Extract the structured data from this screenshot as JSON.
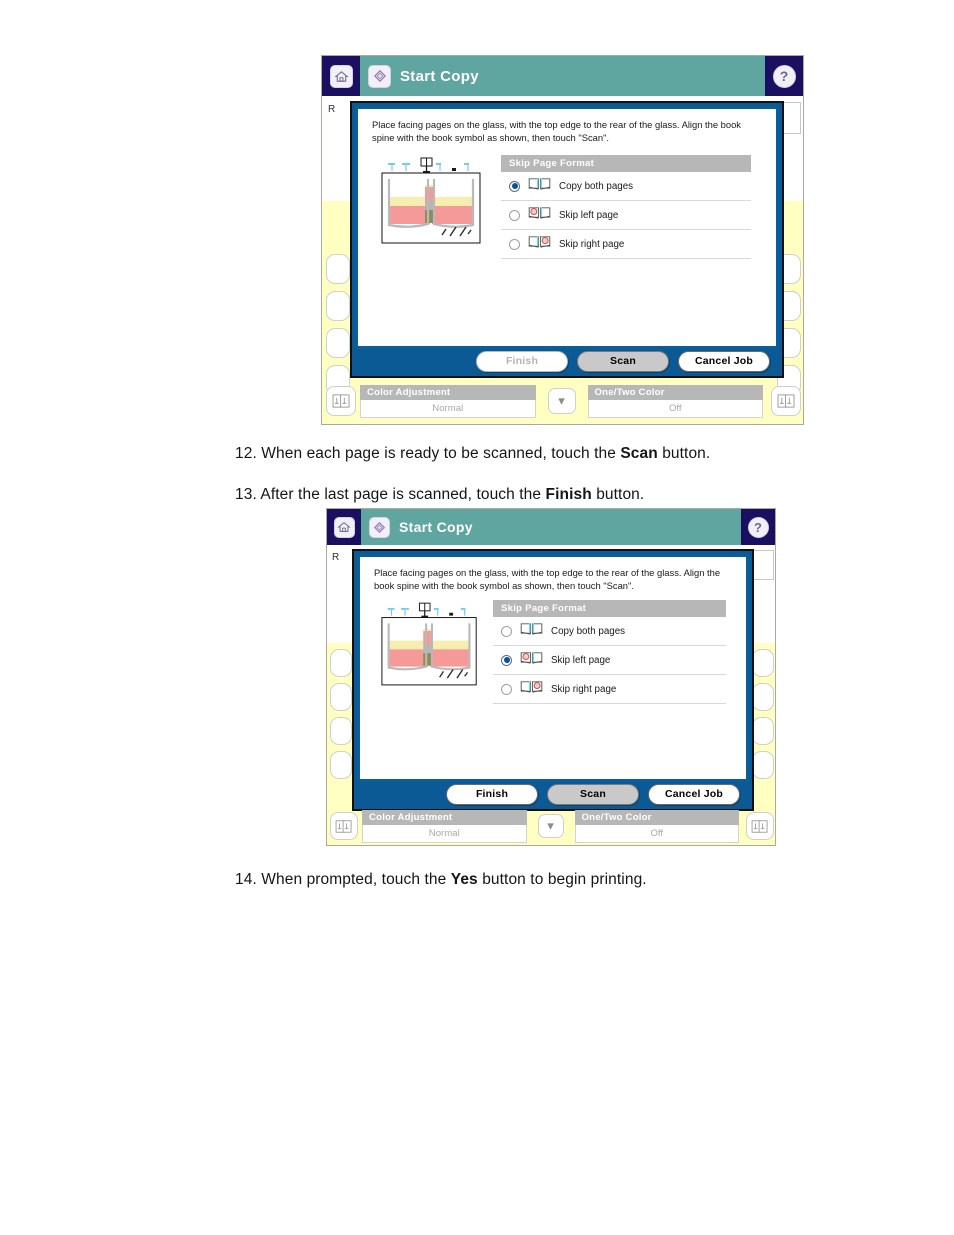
{
  "document": {
    "steps": [
      {
        "number": "12.",
        "text_before": "When each page is ready to be scanned, touch the ",
        "bold": "Scan",
        "text_after": " button."
      },
      {
        "number": "13.",
        "text_before": "After the last page is scanned, touch the ",
        "bold": "Finish",
        "text_after": " button."
      },
      {
        "number": "14.",
        "text_before": "When prompted, touch the ",
        "bold": "Yes",
        "text_after": " button to begin printing."
      }
    ]
  },
  "colors": {
    "header_navy": "#1a0f60",
    "header_teal": "#5fa5a0",
    "dialog_blue": "#0b5a96",
    "panel_yellow": "#ffffc1",
    "section_grey": "#b7b7b7",
    "radio_selected": "#0b4f9e",
    "scan_button_grey": "#c9c9c9"
  },
  "screens": [
    {
      "id": "screen-copy-both",
      "header": {
        "home_icon": "home-icon",
        "app_icon": "diamond-icon",
        "title": "Start Copy",
        "help_icon": "question-mark-icon",
        "help_label": "?"
      },
      "background": {
        "residual_text": "R",
        "tabs_left_count": 5,
        "tabs_right_count": 5
      },
      "dialog": {
        "instruction": "Place facing pages on the glass, with the top edge to the rear of the glass. Align the book spine with the book symbol as shown, then touch \"Scan\".",
        "illustration": "book-on-glass-illustration",
        "section_title": "Skip Page Format",
        "options": [
          {
            "label": "Copy both pages",
            "icon": "open-book-icon",
            "selected": true,
            "enabled": true,
            "skip_side": "none"
          },
          {
            "label": "Skip left page",
            "icon": "open-book-skip-left-icon",
            "selected": false,
            "enabled": false,
            "skip_side": "left"
          },
          {
            "label": "Skip right page",
            "icon": "open-book-skip-right-icon",
            "selected": false,
            "enabled": false,
            "skip_side": "right"
          }
        ],
        "buttons": [
          {
            "label": "Finish",
            "state": "disabled"
          },
          {
            "label": "Scan",
            "state": "highlighted"
          },
          {
            "label": "Cancel Job",
            "state": "normal"
          }
        ]
      },
      "settings_strip": {
        "left_icon": "color-balance-icon",
        "right_icon": "color-balance-icon",
        "chevron_icon": "chevron-down-icon",
        "fields": [
          {
            "title": "Color Adjustment",
            "value": "Normal"
          },
          {
            "title": "One/Two Color",
            "value": "Off"
          }
        ]
      }
    },
    {
      "id": "screen-skip-left",
      "header": {
        "home_icon": "home-icon",
        "app_icon": "diamond-icon",
        "title": "Start Copy",
        "help_icon": "question-mark-icon",
        "help_label": "?"
      },
      "background": {
        "residual_text": "R",
        "tabs_left_count": 5,
        "tabs_right_count": 5
      },
      "dialog": {
        "instruction": "Place facing pages on the glass, with the top edge to the rear of the glass. Align the book spine with the book symbol as shown, then touch \"Scan\".",
        "illustration": "book-on-glass-illustration",
        "section_title": "Skip Page Format",
        "options": [
          {
            "label": "Copy both pages",
            "icon": "open-book-icon",
            "selected": false,
            "enabled": false,
            "skip_side": "none"
          },
          {
            "label": "Skip left page",
            "icon": "open-book-skip-left-icon",
            "selected": true,
            "enabled": true,
            "skip_side": "left"
          },
          {
            "label": "Skip right page",
            "icon": "open-book-skip-right-icon",
            "selected": false,
            "enabled": false,
            "skip_side": "right"
          }
        ],
        "buttons": [
          {
            "label": "Finish",
            "state": "normal"
          },
          {
            "label": "Scan",
            "state": "highlighted"
          },
          {
            "label": "Cancel Job",
            "state": "normal"
          }
        ]
      },
      "settings_strip": {
        "left_icon": "color-balance-icon",
        "right_icon": "color-balance-icon",
        "chevron_icon": "chevron-down-icon",
        "fields": [
          {
            "title": "Color Adjustment",
            "value": "Normal"
          },
          {
            "title": "One/Two Color",
            "value": "Off"
          }
        ]
      }
    }
  ]
}
